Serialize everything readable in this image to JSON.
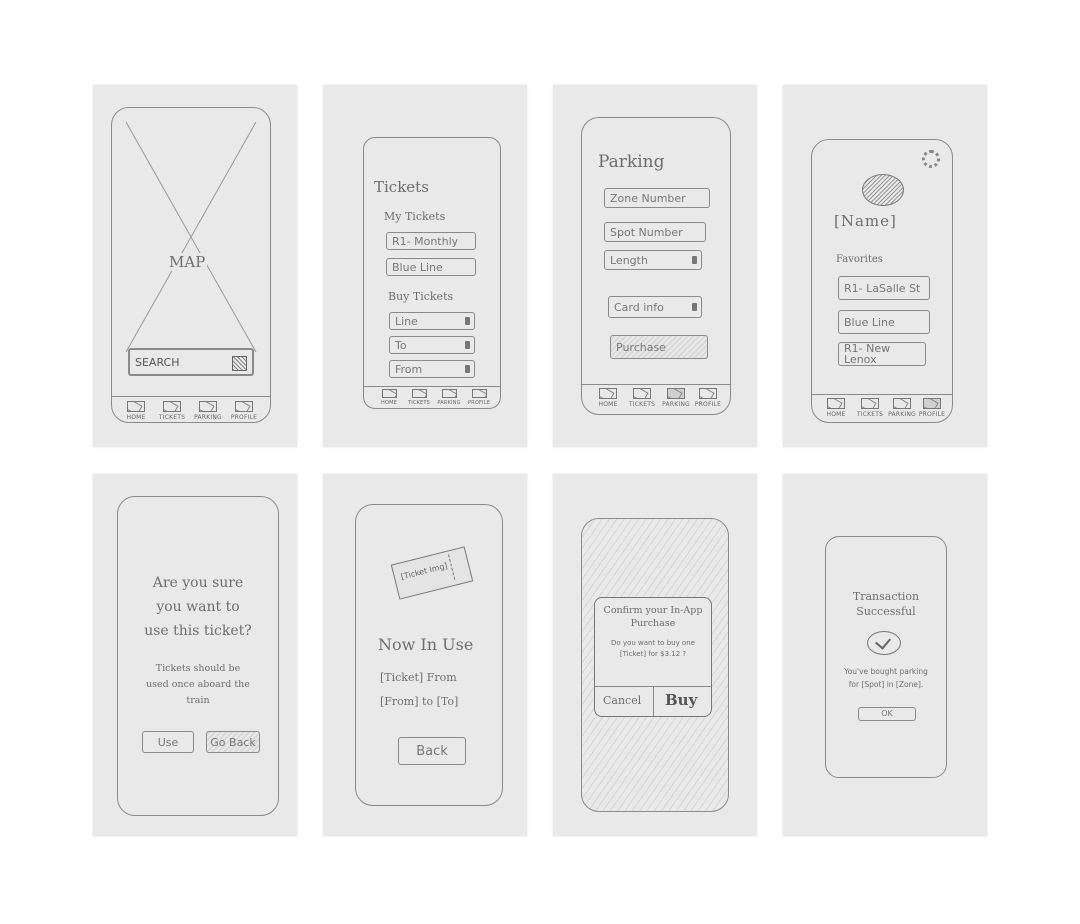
{
  "nav": {
    "home": "HOME",
    "tickets": "TICKETS",
    "parking": "PARKING",
    "profile": "PROFILE"
  },
  "map_screen": {
    "map_label": "MAP",
    "search_placeholder": "SEARCH"
  },
  "tickets_screen": {
    "title": "Tickets",
    "my_tickets_heading": "My Tickets",
    "my_tickets": [
      "R1- Monthly",
      "Blue Line"
    ],
    "buy_tickets_heading": "Buy Tickets",
    "dropdowns": [
      "Line",
      "To",
      "From"
    ]
  },
  "parking_screen": {
    "title": "Parking",
    "fields": [
      "Zone Number",
      "Spot Number",
      "Length"
    ],
    "card_info": "Card info",
    "purchase": "Purchase"
  },
  "profile_screen": {
    "name": "[Name]",
    "favorites_heading": "Favorites",
    "favorites": [
      "R1- LaSalle St",
      "Blue Line",
      "R1- New Lenox"
    ]
  },
  "confirm_use_screen": {
    "question": "Are you sure you want to use this ticket?",
    "note": "Tickets should be used once aboard the train",
    "use_button": "Use",
    "go_back_button": "Go Back"
  },
  "now_in_use_screen": {
    "ticket_label": "[Ticket Img]",
    "heading": "Now In Use",
    "line1": "[Ticket] From",
    "line2": "[From] to [To]",
    "back_button": "Back"
  },
  "in_app_purchase_screen": {
    "title": "Confirm your In-App Purchase",
    "body": "Do you want to buy one [Ticket] for $3.12 ?",
    "cancel_button": "Cancel",
    "buy_button": "Buy"
  },
  "transaction_screen": {
    "title": "Transaction Successful",
    "message": "You've bought parking for [Spot] in [Zone].",
    "ok_button": "OK"
  }
}
